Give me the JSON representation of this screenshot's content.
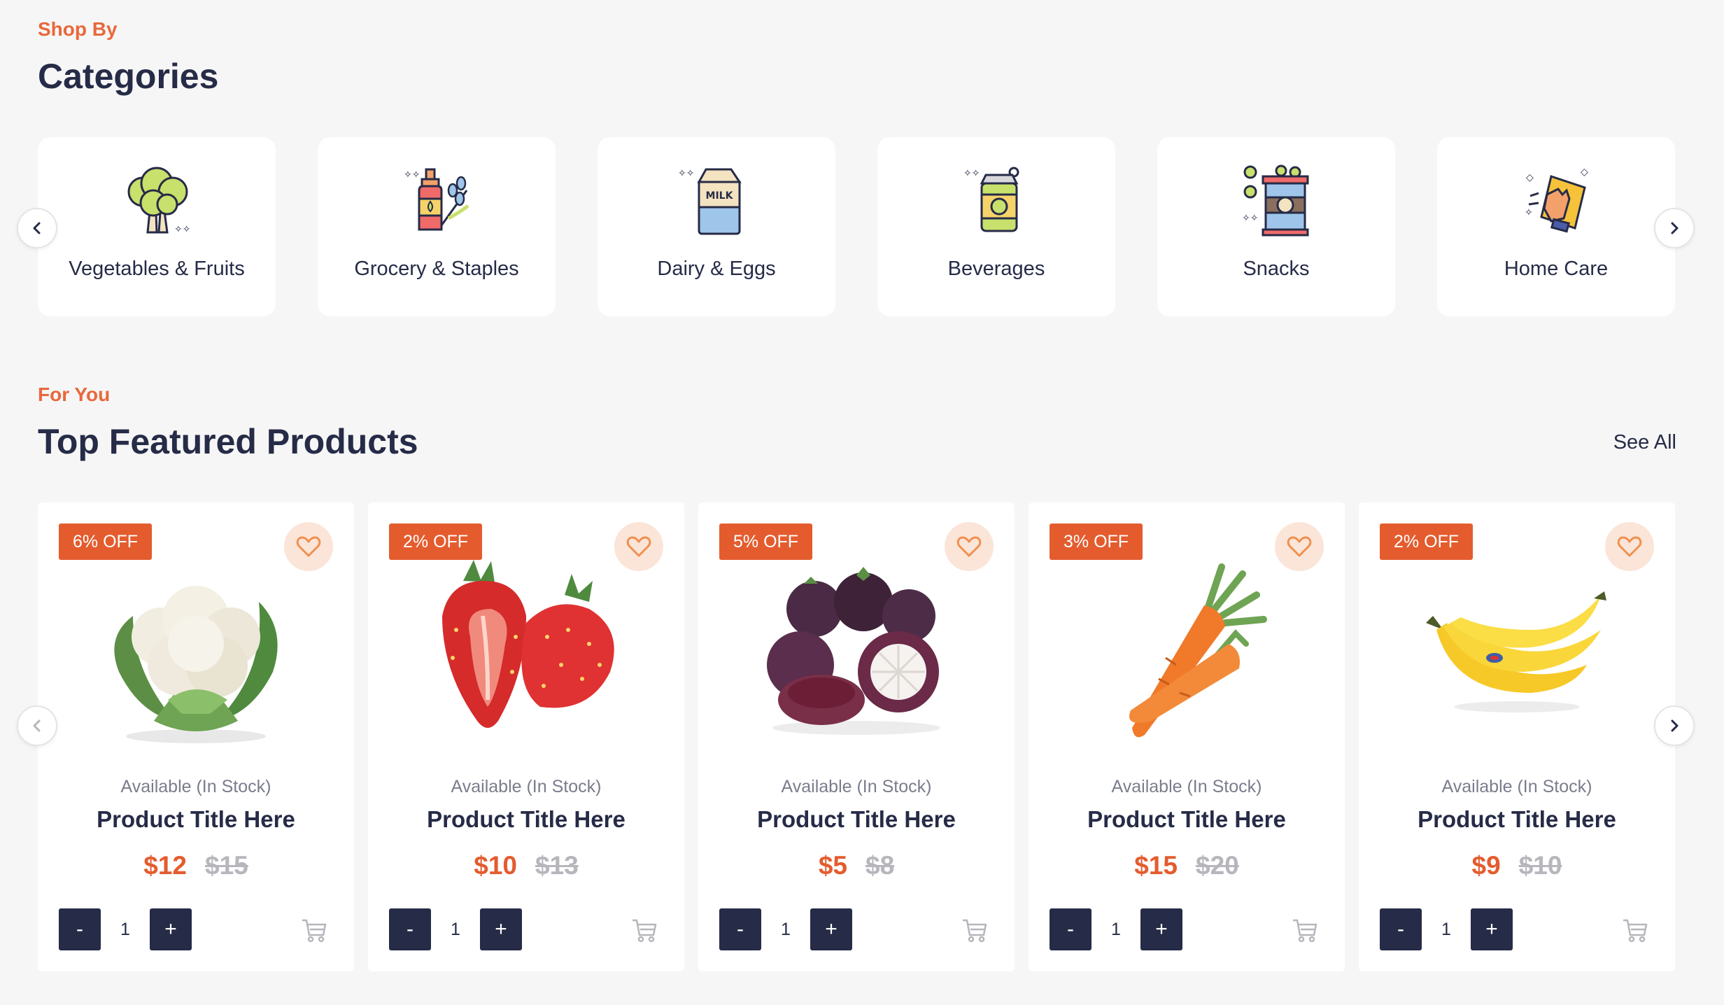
{
  "categories_section": {
    "eyebrow": "Shop By",
    "title": "Categories",
    "items": [
      {
        "label": "Vegetables & Fruits",
        "icon": "broccoli-icon"
      },
      {
        "label": "Grocery & Staples",
        "icon": "oil-bottle-icon"
      },
      {
        "label": "Dairy & Eggs",
        "icon": "milk-carton-icon"
      },
      {
        "label": "Beverages",
        "icon": "soda-can-icon"
      },
      {
        "label": "Snacks",
        "icon": "snack-jar-icon"
      },
      {
        "label": "Home Care",
        "icon": "cleaning-sponge-icon"
      }
    ],
    "milk_text": "MILK"
  },
  "products_section": {
    "eyebrow": "For You",
    "title": "Top Featured Products",
    "see_all": "See All",
    "items": [
      {
        "discount": "6% OFF",
        "availability": "Available  (In Stock)",
        "title": "Product Title Here",
        "price": "$12",
        "old_price": "$15",
        "qty": "1",
        "image": "cauliflower"
      },
      {
        "discount": "2% OFF",
        "availability": "Available  (In Stock)",
        "title": "Product Title Here",
        "price": "$10",
        "old_price": "$13",
        "qty": "1",
        "image": "strawberries"
      },
      {
        "discount": "5% OFF",
        "availability": "Available  (In Stock)",
        "title": "Product Title Here",
        "price": "$5",
        "old_price": "$8",
        "qty": "1",
        "image": "mangosteens"
      },
      {
        "discount": "3% OFF",
        "availability": "Available  (In Stock)",
        "title": "Product Title Here",
        "price": "$15",
        "old_price": "$20",
        "qty": "1",
        "image": "carrots"
      },
      {
        "discount": "2% OFF",
        "availability": "Available  (In Stock)",
        "title": "Product Title Here",
        "price": "$9",
        "old_price": "$10",
        "qty": "1",
        "image": "bananas"
      }
    ],
    "minus_label": "-",
    "plus_label": "+"
  },
  "colors": {
    "accent": "#e8683b",
    "navy": "#262b47",
    "badge": "#e45c2e",
    "fav_bg": "#fbe5d8",
    "background": "#f6f6f6"
  }
}
